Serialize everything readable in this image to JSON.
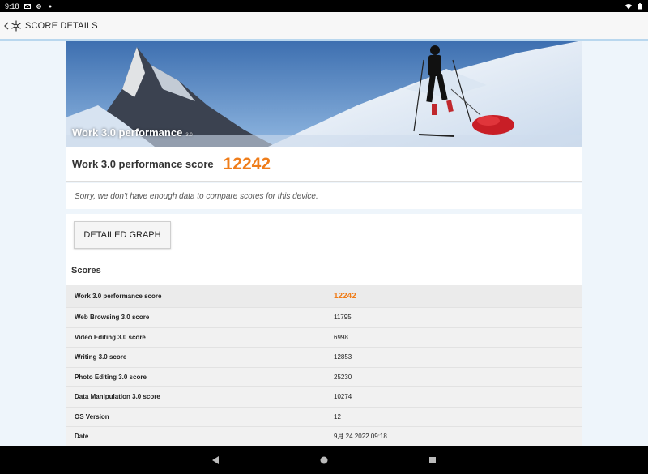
{
  "status_bar": {
    "time": "9:18",
    "left_icons": [
      "mail-icon",
      "settings-cog-icon",
      "dot-icon"
    ],
    "right_icons": [
      "wifi-icon",
      "battery-icon"
    ]
  },
  "app_bar": {
    "title": "SCORE DETAILS"
  },
  "hero": {
    "title": "Work 3.0 performance",
    "version": "3.0"
  },
  "score_card": {
    "label": "Work 3.0 performance score",
    "value": "12242"
  },
  "compare_message": "Sorry, we don't have enough data to compare scores for this device.",
  "detail": {
    "graph_button": "DETAILED GRAPH",
    "scores_heading": "Scores",
    "rows": [
      {
        "name": "Work 3.0 performance score",
        "value": "12242"
      },
      {
        "name": "Web Browsing 3.0 score",
        "value": "11795"
      },
      {
        "name": "Video Editing 3.0 score",
        "value": "6998"
      },
      {
        "name": "Writing 3.0 score",
        "value": "12853"
      },
      {
        "name": "Photo Editing 3.0 score",
        "value": "25230"
      },
      {
        "name": "Data Manipulation 3.0 score",
        "value": "10274"
      },
      {
        "name": "OS Version",
        "value": "12"
      },
      {
        "name": "Date",
        "value": "9月 24 2022 09:18"
      }
    ]
  },
  "colors": {
    "accent": "#ef7d1a",
    "app_bar_border": "#b9d7ee",
    "background": "#eef5fb"
  }
}
